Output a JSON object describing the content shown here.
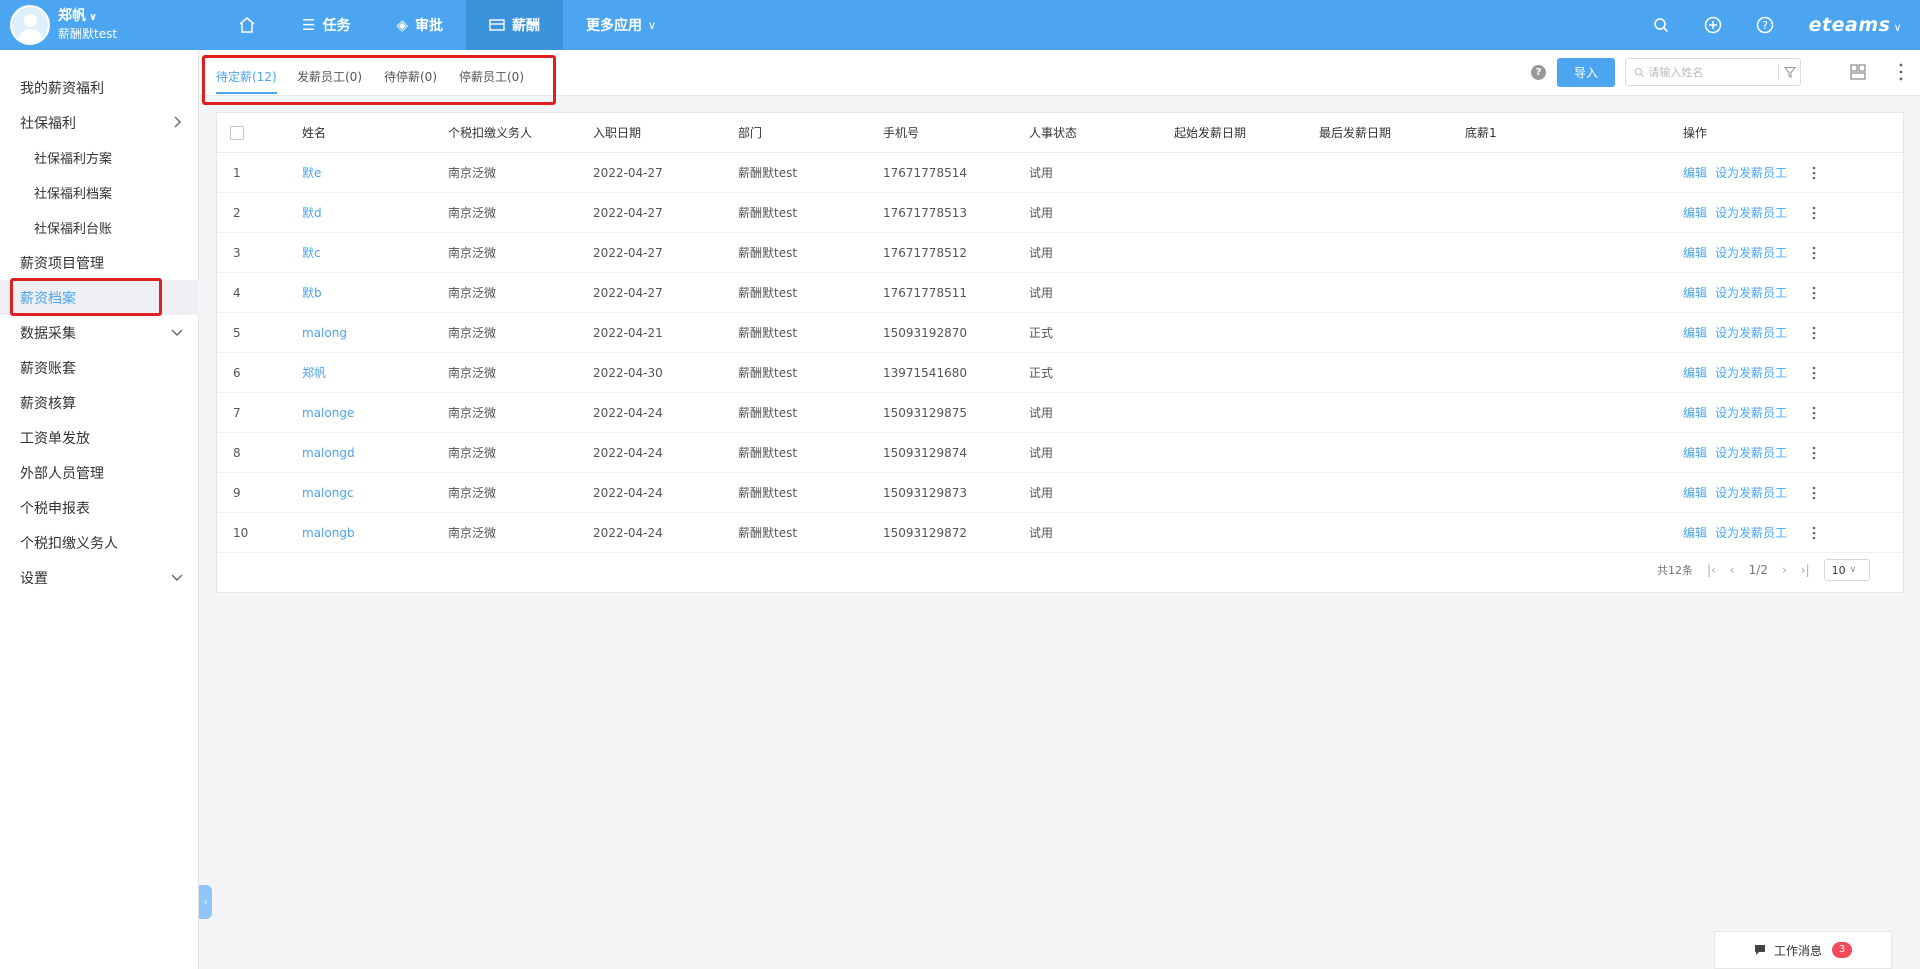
{
  "user": {
    "name": "郑帆",
    "org": "薪酬默test"
  },
  "nav": [
    {
      "label": "",
      "icon": "home-icon"
    },
    {
      "label": "任务",
      "icon": "list-icon"
    },
    {
      "label": "审批",
      "icon": "layers-icon"
    },
    {
      "label": "薪酬",
      "icon": "wallet-icon",
      "active": true
    },
    {
      "label": "更多应用",
      "icon": "chevron-down-icon"
    }
  ],
  "brand": "eteams",
  "sidebar": {
    "items": [
      {
        "label": "我的薪资福利"
      },
      {
        "label": "社保福利"
      },
      {
        "label": "社保福利方案"
      },
      {
        "label": "社保福利档案"
      },
      {
        "label": "社保福利台账"
      },
      {
        "label": "薪资项目管理"
      },
      {
        "label": "薪资档案"
      },
      {
        "label": "数据采集"
      },
      {
        "label": "薪资账套"
      },
      {
        "label": "薪资核算"
      },
      {
        "label": "工资单发放"
      },
      {
        "label": "外部人员管理"
      },
      {
        "label": "个税申报表"
      },
      {
        "label": "个税扣缴义务人"
      },
      {
        "label": "设置"
      }
    ]
  },
  "tabs": [
    {
      "label": "待定薪(12)"
    },
    {
      "label": "发薪员工(0)"
    },
    {
      "label": "待停薪(0)"
    },
    {
      "label": "停薪员工(0)"
    }
  ],
  "toolbar": {
    "help": "?",
    "import_label": "导入",
    "search_placeholder": "请输入姓名"
  },
  "table": {
    "columns": [
      "",
      "姓名",
      "个税扣缴义务人",
      "入职日期",
      "部门",
      "手机号",
      "人事状态",
      "起始发薪日期",
      "最后发薪日期",
      "底薪1",
      "操作"
    ],
    "rows": [
      [
        "1",
        "默e",
        "南京泛微",
        "2022-04-27",
        "薪酬默test",
        "17671778514",
        "试用"
      ],
      [
        "2",
        "默d",
        "南京泛微",
        "2022-04-27",
        "薪酬默test",
        "17671778513",
        "试用"
      ],
      [
        "3",
        "默c",
        "南京泛微",
        "2022-04-27",
        "薪酬默test",
        "17671778512",
        "试用"
      ],
      [
        "4",
        "默b",
        "南京泛微",
        "2022-04-27",
        "薪酬默test",
        "17671778511",
        "试用"
      ],
      [
        "5",
        "malong",
        "南京泛微",
        "2022-04-21",
        "薪酬默test",
        "15093192870",
        "正式"
      ],
      [
        "6",
        "郑帆",
        "南京泛微",
        "2022-04-30",
        "薪酬默test",
        "13971541680",
        "正式"
      ],
      [
        "7",
        "malonge",
        "南京泛微",
        "2022-04-24",
        "薪酬默test",
        "15093129875",
        "试用"
      ],
      [
        "8",
        "malongd",
        "南京泛微",
        "2022-04-24",
        "薪酬默test",
        "15093129874",
        "试用"
      ],
      [
        "9",
        "malongc",
        "南京泛微",
        "2022-04-24",
        "薪酬默test",
        "15093129873",
        "试用"
      ],
      [
        "10",
        "malongb",
        "南京泛微",
        "2022-04-24",
        "薪酬默test",
        "15093129872",
        "试用"
      ]
    ],
    "row_actions": {
      "edit": "编辑",
      "set_payroll": "设为发薪员工"
    }
  },
  "pagination": {
    "total": "共12条",
    "page": "1/2",
    "page_size": "10"
  },
  "messages": {
    "label": "工作消息",
    "count": "3"
  },
  "colors": {
    "primary": "#4ba5f0",
    "highlight": "#e02020",
    "badge": "#f5495c"
  }
}
